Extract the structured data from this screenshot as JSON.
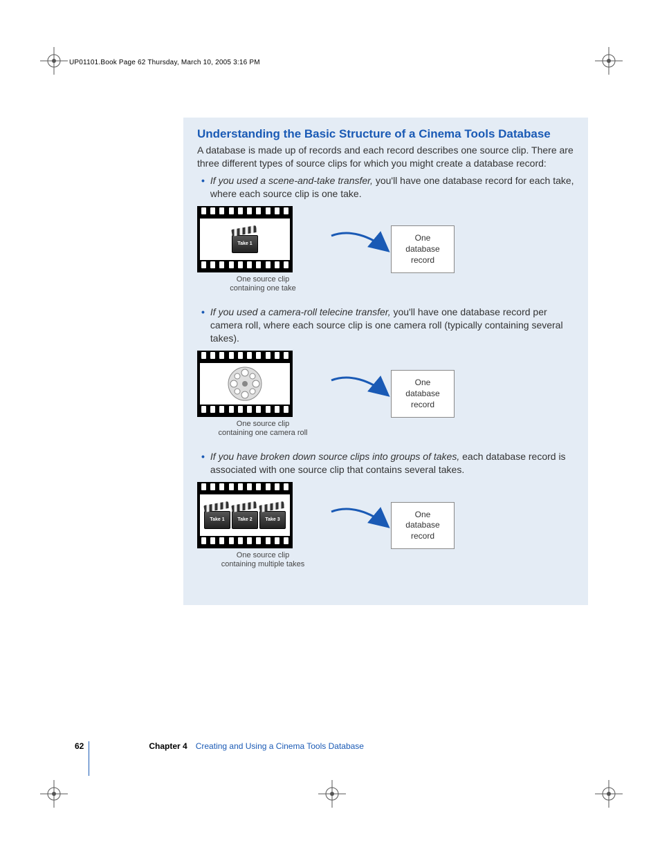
{
  "header": "UP01101.Book  Page 62  Thursday, March 10, 2005  3:16 PM",
  "section_title": "Understanding the Basic Structure of a Cinema Tools Database",
  "intro": "A database is made up of records and each record describes one source clip. There are three different types of source clips for which you might create a database record:",
  "bullets": [
    {
      "lead": "If you used a scene-and-take transfer,",
      "rest": " you'll have one database record for each take, where each source clip is one take."
    },
    {
      "lead": "If you used a camera-roll telecine transfer,",
      "rest": " you'll have one database record per camera roll, where each source clip is one camera roll (typically containing several takes)."
    },
    {
      "lead": "If you have broken down source clips into groups of takes,",
      "rest": " each database record is associated with one source clip that contains several takes."
    }
  ],
  "diagrams": [
    {
      "slates": [
        "Take 1"
      ],
      "caption_line1": "One source clip",
      "caption_line2": "containing one take",
      "record_l1": "One",
      "record_l2": "database",
      "record_l3": "record"
    },
    {
      "slates": [],
      "reel": true,
      "caption_line1": "One source clip",
      "caption_line2": "containing one camera roll",
      "record_l1": "One",
      "record_l2": "database",
      "record_l3": "record"
    },
    {
      "slates": [
        "Take 1",
        "Take 2",
        "Take 3"
      ],
      "caption_line1": "One source clip",
      "caption_line2": "containing multiple takes",
      "record_l1": "One",
      "record_l2": "database",
      "record_l3": "record"
    }
  ],
  "footer": {
    "page": "62",
    "chapter_label": "Chapter 4",
    "chapter_title": "Creating and Using a Cinema Tools Database"
  }
}
